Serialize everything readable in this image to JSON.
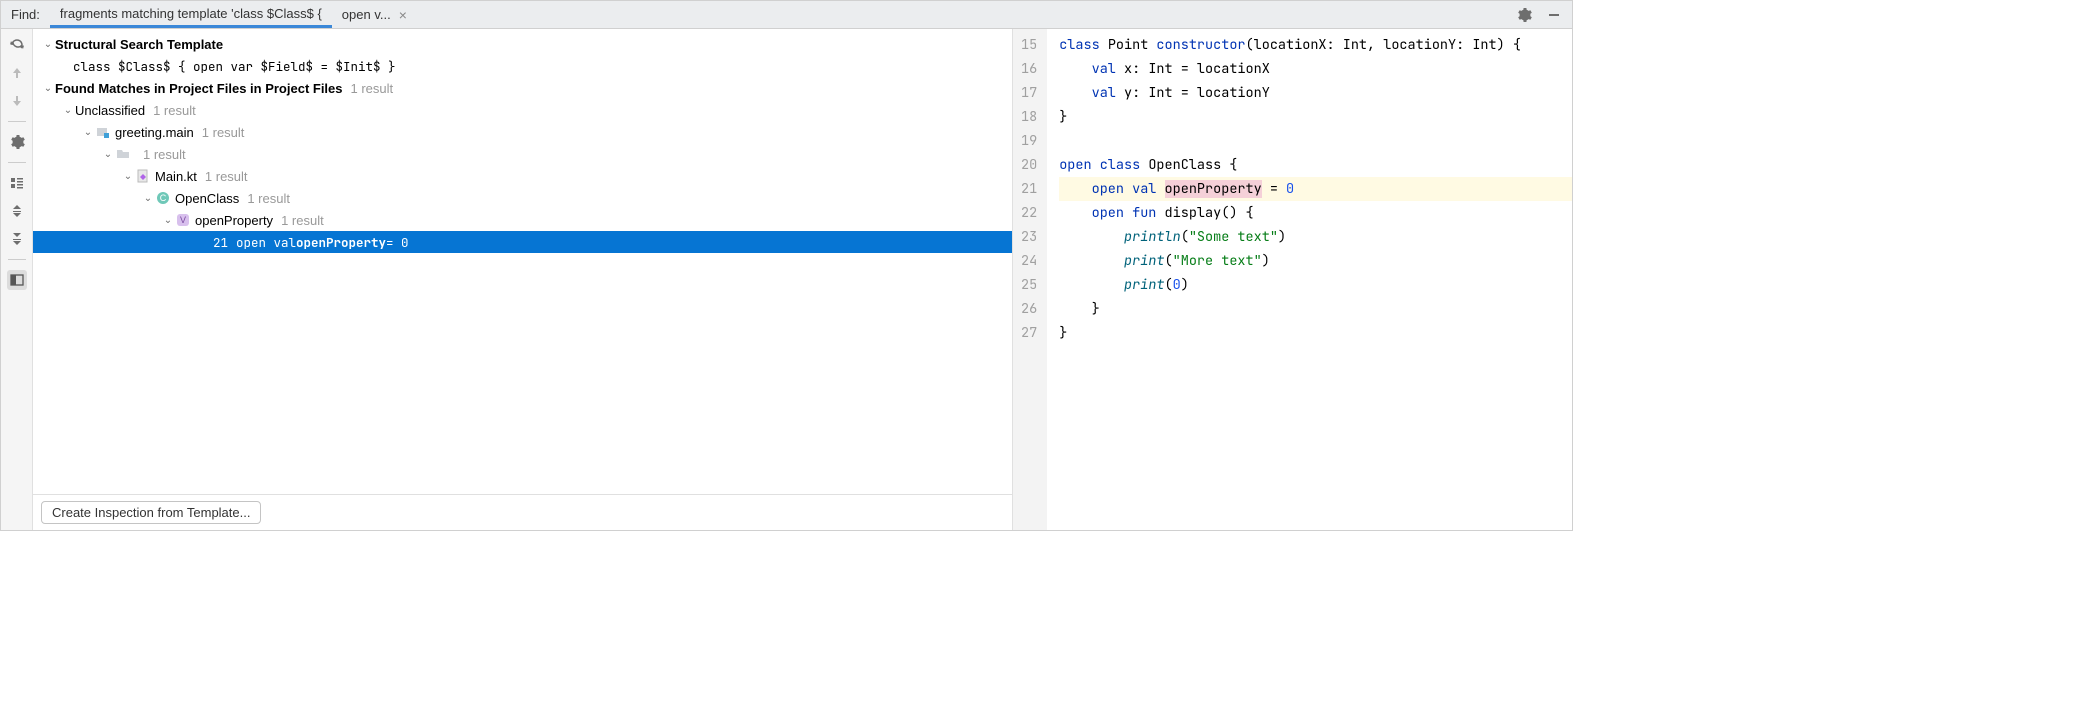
{
  "header": {
    "find_label": "Find:",
    "tabs": [
      {
        "label": "fragments matching template 'class $Class$ {",
        "active": true
      },
      {
        "label": "open v...",
        "active": false,
        "closable": true
      }
    ]
  },
  "tree": {
    "template_heading": "Structural Search Template",
    "template_code": "class $Class$ {     open var $Field$ = $Init$ }",
    "found_heading": "Found Matches in Project Files in Project Files",
    "found_count": "1 result",
    "nodes": {
      "unclassified": {
        "label": "Unclassified",
        "count": "1 result"
      },
      "module": {
        "label": "greeting.main",
        "count": "1 result"
      },
      "folder": {
        "label": "",
        "count": "1 result"
      },
      "file": {
        "label": "Main.kt",
        "count": "1 result"
      },
      "class": {
        "label": "OpenClass",
        "count": "1 result"
      },
      "prop": {
        "label": "openProperty",
        "count": "1 result"
      },
      "match": {
        "lineno": "21",
        "prefix": "open val ",
        "bold": "openProperty",
        "suffix": " = 0"
      }
    }
  },
  "footer": {
    "button": "Create Inspection from Template..."
  },
  "editor": {
    "lines": [
      {
        "n": 15,
        "parts": [
          {
            "t": "class ",
            "c": "kw"
          },
          {
            "t": "Point ",
            "c": "cls"
          },
          {
            "t": "constructor",
            "c": "kw"
          },
          {
            "t": "(locationX: Int, locationY: Int) {",
            "c": ""
          }
        ]
      },
      {
        "n": 16,
        "parts": [
          {
            "t": "    ",
            "c": ""
          },
          {
            "t": "val ",
            "c": "kw"
          },
          {
            "t": "x: Int = locationX",
            "c": ""
          }
        ]
      },
      {
        "n": 17,
        "parts": [
          {
            "t": "    ",
            "c": ""
          },
          {
            "t": "val ",
            "c": "kw"
          },
          {
            "t": "y: Int = locationY",
            "c": ""
          }
        ]
      },
      {
        "n": 18,
        "parts": [
          {
            "t": "}",
            "c": ""
          }
        ]
      },
      {
        "n": 19,
        "parts": [
          {
            "t": "",
            "c": ""
          }
        ]
      },
      {
        "n": 20,
        "parts": [
          {
            "t": "open class ",
            "c": "kw"
          },
          {
            "t": "OpenClass {",
            "c": "cls"
          }
        ]
      },
      {
        "n": 21,
        "hl": true,
        "parts": [
          {
            "t": "    ",
            "c": ""
          },
          {
            "t": "open val ",
            "c": "kw"
          },
          {
            "t": "openProperty",
            "c": "prop-hl"
          },
          {
            "t": " = ",
            "c": ""
          },
          {
            "t": "0",
            "c": "num"
          }
        ]
      },
      {
        "n": 22,
        "parts": [
          {
            "t": "    ",
            "c": ""
          },
          {
            "t": "open fun ",
            "c": "kw"
          },
          {
            "t": "display() {",
            "c": "decl"
          }
        ]
      },
      {
        "n": 23,
        "parts": [
          {
            "t": "        ",
            "c": ""
          },
          {
            "t": "println",
            "c": "fn"
          },
          {
            "t": "(",
            "c": ""
          },
          {
            "t": "\"Some text\"",
            "c": "str"
          },
          {
            "t": ")",
            "c": ""
          }
        ]
      },
      {
        "n": 24,
        "parts": [
          {
            "t": "        ",
            "c": ""
          },
          {
            "t": "print",
            "c": "fn"
          },
          {
            "t": "(",
            "c": ""
          },
          {
            "t": "\"More text\"",
            "c": "str"
          },
          {
            "t": ")",
            "c": ""
          }
        ]
      },
      {
        "n": 25,
        "parts": [
          {
            "t": "        ",
            "c": ""
          },
          {
            "t": "print",
            "c": "fn"
          },
          {
            "t": "(",
            "c": ""
          },
          {
            "t": "0",
            "c": "num"
          },
          {
            "t": ")",
            "c": ""
          }
        ]
      },
      {
        "n": 26,
        "parts": [
          {
            "t": "    }",
            "c": ""
          }
        ]
      },
      {
        "n": 27,
        "parts": [
          {
            "t": "}",
            "c": ""
          }
        ]
      }
    ]
  }
}
